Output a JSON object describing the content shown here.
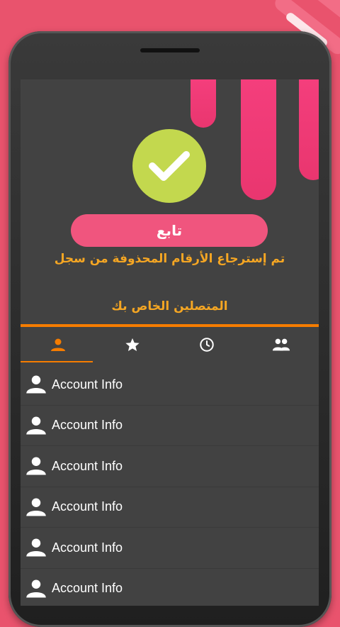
{
  "colors": {
    "background": "#e9536d",
    "screen": "#424242",
    "accent_pink": "#f43e7c",
    "check_green": "#c3d84e",
    "orange": "#f57c00",
    "message_text": "#f5a623"
  },
  "header": {
    "follow_button_label": "تابع",
    "message_line1": "تم إسترجاع الأرقام المحذوفة من سجل",
    "message_line2": "المتصلين الخاص بك"
  },
  "tabs": [
    {
      "icon": "person-icon",
      "selected": true
    },
    {
      "icon": "star-icon",
      "selected": false
    },
    {
      "icon": "clock-icon",
      "selected": false
    },
    {
      "icon": "group-icon",
      "selected": false
    }
  ],
  "contacts": [
    {
      "label": "Account Info",
      "icon": "person-icon"
    },
    {
      "label": "Account Info",
      "icon": "person-icon"
    },
    {
      "label": "Account Info",
      "icon": "person-icon"
    },
    {
      "label": "Account Info",
      "icon": "person-icon"
    },
    {
      "label": "Account Info",
      "icon": "person-icon"
    },
    {
      "label": "Account Info",
      "icon": "person-icon"
    }
  ]
}
